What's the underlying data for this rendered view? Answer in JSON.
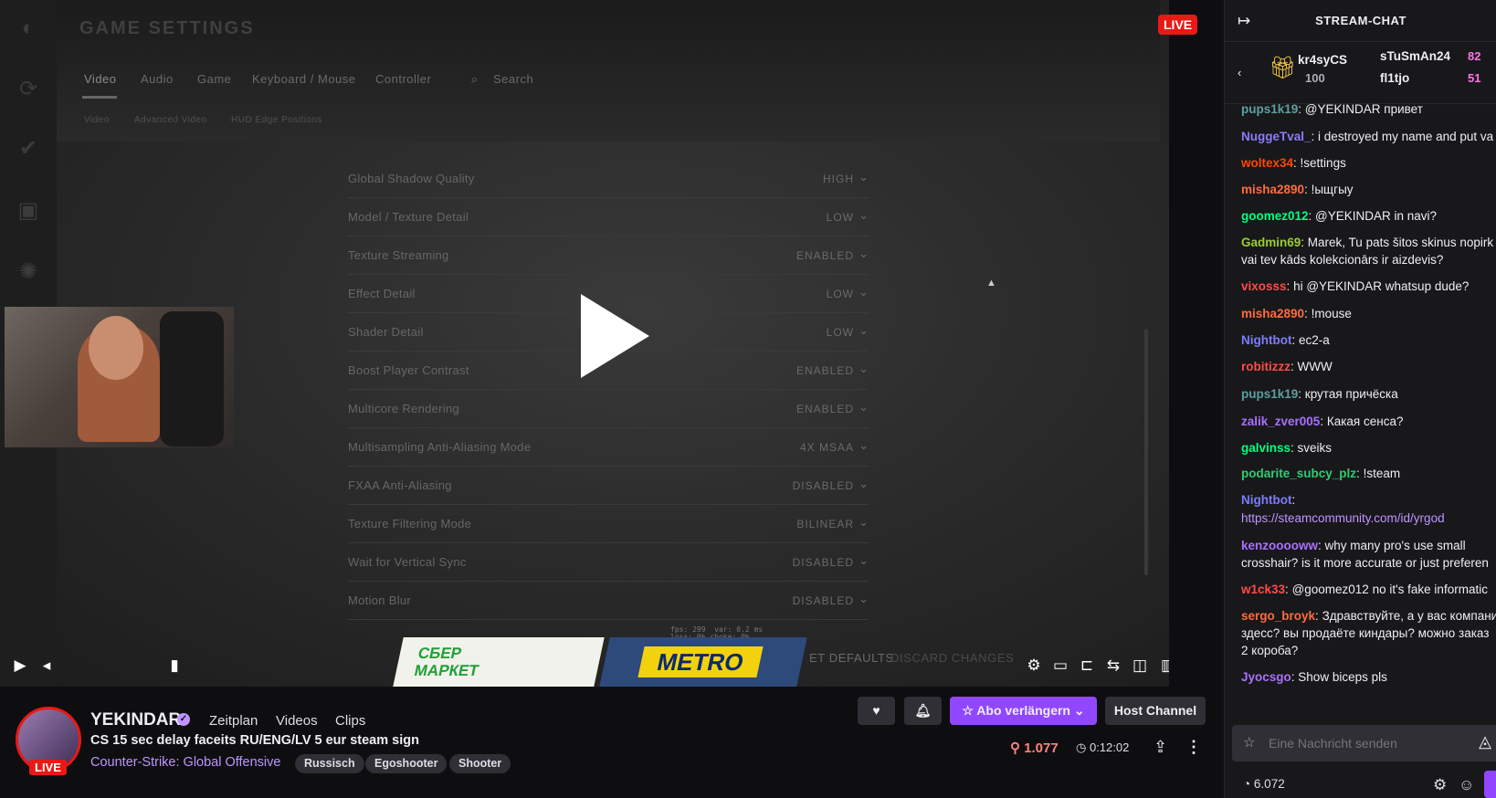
{
  "game_settings": {
    "title": "GAME SETTINGS",
    "tabs": [
      "Video",
      "Audio",
      "Game",
      "Keyboard / Mouse",
      "Controller"
    ],
    "search": "Search",
    "subtabs": [
      "Video",
      "Advanced Video",
      "HUD Edge Positions"
    ],
    "rows": [
      {
        "label": "Global Shadow Quality",
        "value": "HIGH"
      },
      {
        "label": "Model / Texture Detail",
        "value": "LOW"
      },
      {
        "label": "Texture Streaming",
        "value": "ENABLED"
      },
      {
        "label": "Effect Detail",
        "value": "LOW"
      },
      {
        "label": "Shader Detail",
        "value": "LOW"
      },
      {
        "label": "Boost Player Contrast",
        "value": "ENABLED"
      },
      {
        "label": "Multicore Rendering",
        "value": "ENABLED"
      },
      {
        "label": "Multisampling Anti-Aliasing Mode",
        "value": "4X MSAA"
      },
      {
        "label": "FXAA Anti-Aliasing",
        "value": "DISABLED"
      },
      {
        "label": "Texture Filtering Mode",
        "value": "BILINEAR"
      },
      {
        "label": "Wait for Vertical Sync",
        "value": "DISABLED"
      },
      {
        "label": "Motion Blur",
        "value": "DISABLED"
      }
    ],
    "reset_defaults": "ET DEFAULTS",
    "discard_changes": "DISCARD CHANGES"
  },
  "ads": {
    "sber": "СБЕР\nМАРКЕТ",
    "metro": "METRO"
  },
  "player": {
    "live_label": "LIVE"
  },
  "channel": {
    "name": "YEKINDAR",
    "avatar_live": "LIVE",
    "links": [
      "Zeitplan",
      "Videos",
      "Clips"
    ],
    "stream_title": "CS 15 sec delay faceits RU/ENG/LV 5 eur steam sign",
    "game": "Counter-Strike: Global Offensive",
    "tags": [
      "Russisch",
      "Egoshooter",
      "Shooter"
    ],
    "viewers": "1.077",
    "uptime": "0:12:02",
    "subscribe_label": "Abo verlängern",
    "host_label": "Host Channel"
  },
  "chat": {
    "title": "STREAM-CHAT",
    "gifters": [
      {
        "name": "kr4syCS",
        "count": "100"
      },
      {
        "name": "sTuSmAn24",
        "count": "82"
      },
      {
        "name": "fl1tjo",
        "count": "51"
      }
    ],
    "messages": [
      {
        "user": "pups1k19",
        "color": "#5f9ea0",
        "text": "@YEKINDAR привет"
      },
      {
        "user": "NuggeTval_",
        "color": "#8a7cff",
        "text": "i destroyed my name and put va"
      },
      {
        "user": "woltex34",
        "color": "#ff4500",
        "text": "!settings"
      },
      {
        "user": "misha2890",
        "color": "#ff6b3d",
        "text": "!ыщгыу"
      },
      {
        "user": "goomez012",
        "color": "#00ff7f",
        "text": "@YEKINDAR in navi?"
      },
      {
        "user": "Gadmin69",
        "color": "#9acd32",
        "text": "Marek, Tu pats šitos skinus nopirk"
      },
      {
        "user": "",
        "color": "#efeff1",
        "text": "vai tev kāds kolekcionārs ir aizdevis?"
      },
      {
        "user": "vixosss",
        "color": "#ff4a4a",
        "text": "hi @YEKINDAR whatsup dude?"
      },
      {
        "user": "misha2890",
        "color": "#ff6b3d",
        "text": "!mouse"
      },
      {
        "user": "Nightbot",
        "color": "#7c7cff",
        "text": "ec2-a"
      },
      {
        "user": "robitizzz",
        "color": "#ff4a4a",
        "text": "WWW"
      },
      {
        "user": "pups1k19",
        "color": "#5f9ea0",
        "text": "крутая причёска"
      },
      {
        "user": "zalik_zver005",
        "color": "#a970ff",
        "text": "Какая сенса?"
      },
      {
        "user": "galvinss",
        "color": "#00ff7f",
        "text": "sveiks"
      },
      {
        "user": "podarite_subcy_plz",
        "color": "#2ecc71",
        "text": "!steam"
      },
      {
        "user": "Nightbot",
        "color": "#7c7cff",
        "text": ""
      },
      {
        "user": "",
        "color": "#bf94ff",
        "text": "https://steamcommunity.com/id/yrgod"
      },
      {
        "user": "kenzooooww",
        "color": "#a970ff",
        "text": "why many pro's use small"
      },
      {
        "user": "",
        "color": "#efeff1",
        "text": "crosshair? is it more accurate or just preferen"
      },
      {
        "user": "w1ck33",
        "color": "#ff4a4a",
        "text": "@goomez012 no it's fake informatic"
      },
      {
        "user": "sergo_broyk",
        "color": "#ff6b3d",
        "text": "Здравствуйте, а у вас компани"
      },
      {
        "user": "",
        "color": "#efeff1",
        "text": "здесс? вы продаёте киндары? можно заказ"
      },
      {
        "user": "",
        "color": "#efeff1",
        "text": "2 короба?"
      },
      {
        "user": "Jyocsgo",
        "color": "#a970ff",
        "text": "Show biceps pls"
      }
    ],
    "input_placeholder": "Eine Nachricht senden",
    "points": "6.072"
  }
}
